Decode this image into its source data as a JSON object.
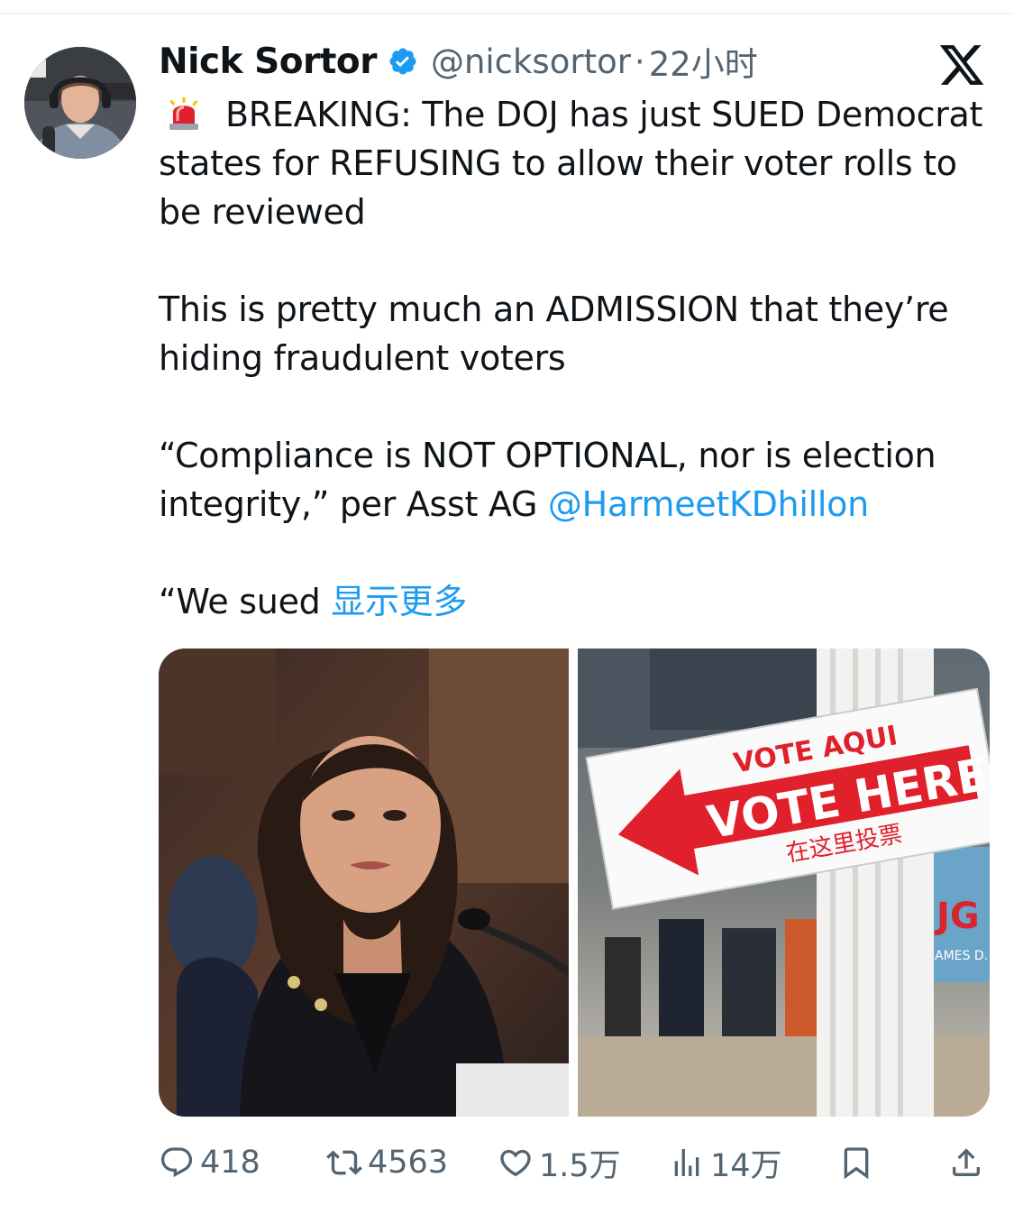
{
  "author": {
    "name": "Nick Sortor",
    "handle": "@nicksortor",
    "separator": "·",
    "time": "22小时",
    "verified": true
  },
  "platform_icon": "x-logo-icon",
  "tweet": {
    "line1": "BREAKING: The DOJ has just SUED Democrat states for REFUSING to allow their voter rolls to be reviewed",
    "line2": "This is pretty much an ADMISSION that they’re hiding fraudulent voters",
    "line3_text": "“Compliance is NOT OPTIONAL, nor is election integrity,” per Asst AG ",
    "mention": "@HarmeetKDhillon",
    "line4_text": "“We sued ",
    "show_more": "显示更多"
  },
  "media": {
    "photo2_sign": {
      "top": "VOTE AQUI",
      "main": "VOTE HERE",
      "chinese": "在这里投票"
    },
    "photo2_poster": {
      "line1": "JG",
      "line2": "AMES D."
    }
  },
  "actions": {
    "replies": "418",
    "reposts": "4563",
    "likes": "1.5万",
    "views": "14万"
  },
  "colors": {
    "accent": "#1d9bf0",
    "secondary_text": "#536471",
    "primary_text": "#0f1419",
    "sign_red": "#e0202a"
  }
}
